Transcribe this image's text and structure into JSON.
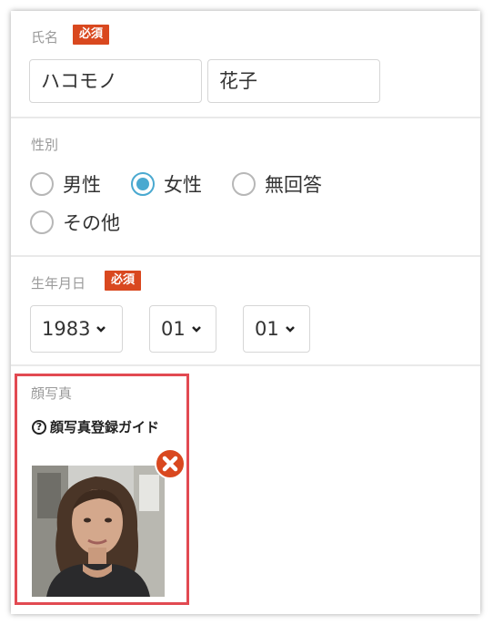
{
  "name_section": {
    "label": "氏名",
    "required_badge": "必須",
    "last_name": "ハコモノ",
    "first_name": "花子"
  },
  "gender_section": {
    "label": "性別",
    "options": [
      "男性",
      "女性",
      "無回答",
      "その他"
    ],
    "selected": "女性"
  },
  "birthday_section": {
    "label": "生年月日",
    "required_badge": "必須",
    "year": "1983",
    "month": "01",
    "day": "01"
  },
  "photo_section": {
    "label": "顔写真",
    "guide_text": "顔写真登録ガイド",
    "guide_icon": "question-circle-icon",
    "remove_icon": "close-icon"
  },
  "colors": {
    "required_badge": "#d9481f",
    "radio_selected": "#4aa9d0",
    "photo_highlight_border": "#e24a52"
  }
}
